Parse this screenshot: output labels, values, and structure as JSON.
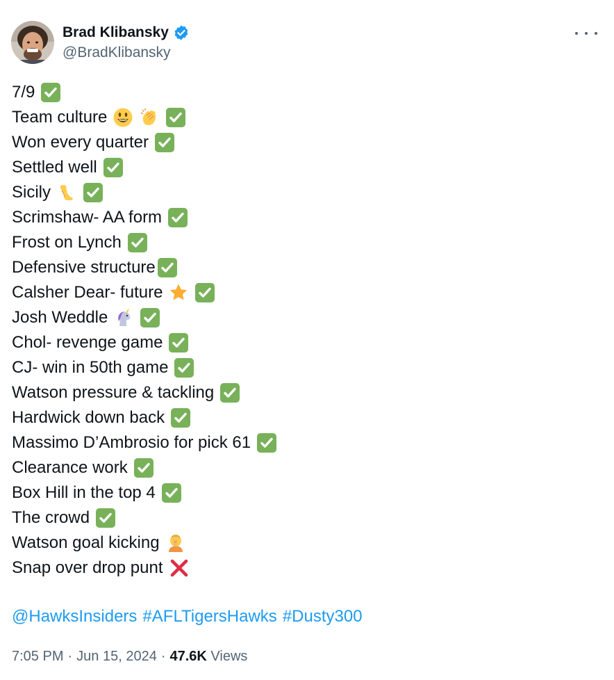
{
  "author": {
    "display_name": "Brad Klibansky",
    "handle": "@BradKlibansky",
    "verified": true,
    "verified_color": "#1d9bf0"
  },
  "body": {
    "lines": [
      {
        "text": "7/9",
        "emojis": [
          "check"
        ]
      },
      {
        "text": "Team culture",
        "emojis": [
          "smiley",
          "clap",
          "check"
        ]
      },
      {
        "text": "Won every quarter",
        "emojis": [
          "check"
        ]
      },
      {
        "text": "Settled well",
        "emojis": [
          "check"
        ]
      },
      {
        "text": "Sicily",
        "emojis": [
          "leg",
          "check"
        ]
      },
      {
        "text": "Scrimshaw- AA form",
        "emojis": [
          "check"
        ]
      },
      {
        "text": "Frost on Lynch",
        "emojis": [
          "check"
        ]
      },
      {
        "text": "Defensive structure",
        "emojis": [
          "check"
        ],
        "tight": true
      },
      {
        "text": "Calsher Dear- future",
        "emojis": [
          "star",
          "check"
        ]
      },
      {
        "text": "Josh Weddle",
        "emojis": [
          "unicorn",
          "check"
        ]
      },
      {
        "text": "Chol- revenge game",
        "emojis": [
          "check"
        ]
      },
      {
        "text": "CJ- win in 50th game",
        "emojis": [
          "check"
        ]
      },
      {
        "text": "Watson pressure & tackling",
        "emojis": [
          "check"
        ]
      },
      {
        "text": "Hardwick down back",
        "emojis": [
          "check"
        ]
      },
      {
        "text": "Massimo D’Ambrosio for pick 61",
        "emojis": [
          "check"
        ]
      },
      {
        "text": "Clearance work",
        "emojis": [
          "check"
        ]
      },
      {
        "text": "Box Hill in the top 4",
        "emojis": [
          "check"
        ]
      },
      {
        "text": "The crowd",
        "emojis": [
          "check"
        ]
      },
      {
        "text": "Watson goal kicking",
        "emojis": [
          "facepalm"
        ]
      },
      {
        "text": "Snap over drop punt",
        "emojis": [
          "cross"
        ]
      }
    ]
  },
  "links": {
    "mention": "@HawksInsiders",
    "hashtag1": "#AFLTigersHawks",
    "hashtag2": "#Dusty300"
  },
  "meta": {
    "time": "7:05 PM",
    "date": "Jun 15, 2024",
    "views_count": "47.6K",
    "views_label": "Views"
  },
  "colors": {
    "text": "#0f1419",
    "secondary": "#536471",
    "link": "#1d9bf0",
    "check_green": "#78b159"
  }
}
